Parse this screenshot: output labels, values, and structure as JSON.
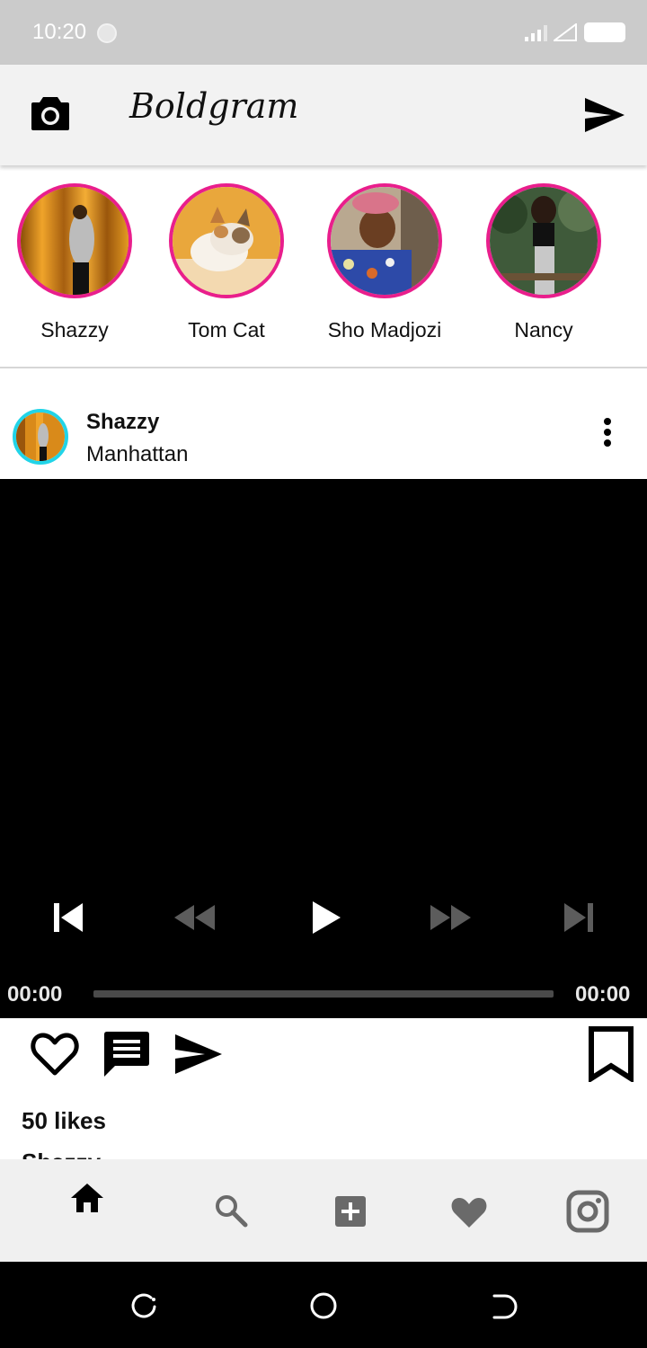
{
  "status_bar": {
    "time": "10:20"
  },
  "app_bar": {
    "title": "Boldgram",
    "camera_icon": "camera-icon",
    "direct_icon": "send-icon"
  },
  "stories": [
    {
      "name": "Shazzy"
    },
    {
      "name": "Tom Cat"
    },
    {
      "name": "Sho Madjozi"
    },
    {
      "name": "Nancy"
    }
  ],
  "post": {
    "user": "Shazzy",
    "location": "Manhattan",
    "player": {
      "current_time": "00:00",
      "total_time": "00:00",
      "progress": 0
    },
    "likes": "50 likes",
    "caption_user": "Shazzy"
  },
  "colors": {
    "story_ring": "#e91e8c",
    "avatar_ring": "#21d4e8",
    "app_bar_bg": "#f2f2f2"
  },
  "bottom_nav": [
    "home-icon",
    "search-icon",
    "add-box-icon",
    "heart-icon",
    "instagram-icon"
  ]
}
